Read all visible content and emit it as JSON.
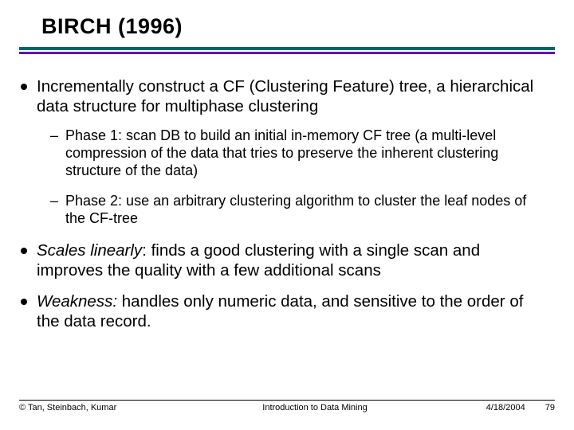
{
  "title": "BIRCH (1996)",
  "bullets": [
    {
      "text": "Incrementally construct a CF (Clustering Feature) tree, a hierarchical data structure for multiphase clustering",
      "sub": [
        "Phase 1: scan DB to build an initial in-memory CF tree (a multi-level compression of the data that tries to preserve the inherent clustering structure of the data)",
        "Phase 2: use an arbitrary clustering algorithm to cluster the leaf nodes of the CF-tree"
      ]
    },
    {
      "lead": "Scales linearly",
      "rest": ": finds a good clustering with a single scan and improves the quality with a few additional scans"
    },
    {
      "lead": "Weakness:",
      "rest": " handles only numeric data, and sensitive to the order of the data record."
    }
  ],
  "footer": {
    "left": "© Tan, Steinbach, Kumar",
    "mid": "Introduction to Data Mining",
    "date": "4/18/2004",
    "page": "79"
  }
}
